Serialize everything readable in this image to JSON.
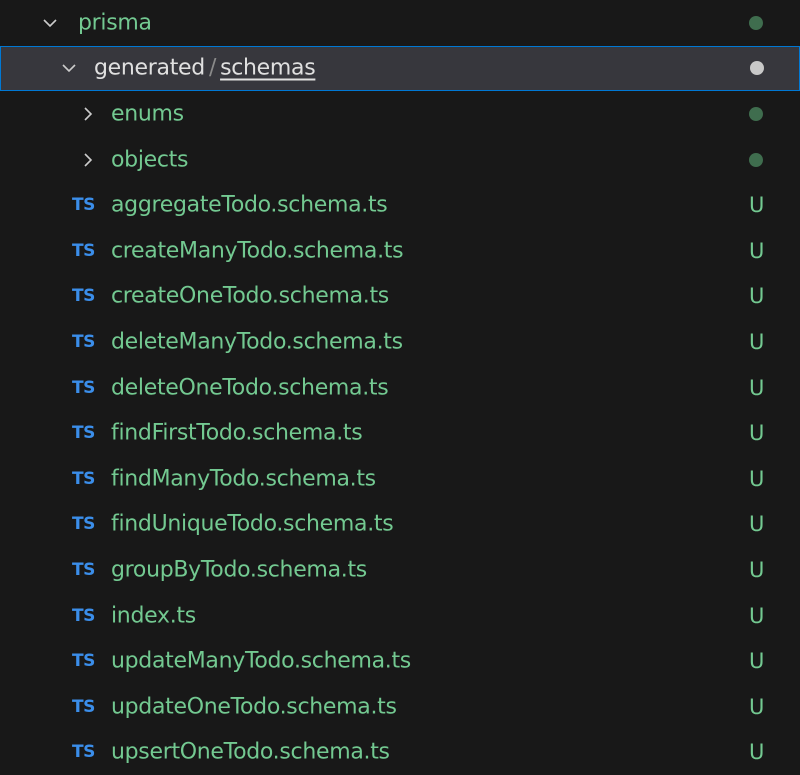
{
  "explorer": {
    "root_folder": {
      "label": "prisma",
      "expanded": true,
      "status": "dot",
      "status_color": "#3f6d4e"
    },
    "selected_folder": {
      "label_part1": "generated",
      "separator": "/",
      "label_part2": "schemas",
      "expanded": true,
      "status": "dot",
      "status_color": "#c8c8c8"
    },
    "subfolders": [
      {
        "label": "enums",
        "expanded": false,
        "status": "dot",
        "status_color": "#3f6d4e"
      },
      {
        "label": "objects",
        "expanded": false,
        "status": "dot",
        "status_color": "#3f6d4e"
      }
    ],
    "file_icon_text": "TS",
    "files": [
      {
        "label": "aggregateTodo.schema.ts",
        "status": "U"
      },
      {
        "label": "createManyTodo.schema.ts",
        "status": "U"
      },
      {
        "label": "createOneTodo.schema.ts",
        "status": "U"
      },
      {
        "label": "deleteManyTodo.schema.ts",
        "status": "U"
      },
      {
        "label": "deleteOneTodo.schema.ts",
        "status": "U"
      },
      {
        "label": "findFirstTodo.schema.ts",
        "status": "U"
      },
      {
        "label": "findManyTodo.schema.ts",
        "status": "U"
      },
      {
        "label": "findUniqueTodo.schema.ts",
        "status": "U"
      },
      {
        "label": "groupByTodo.schema.ts",
        "status": "U"
      },
      {
        "label": "index.ts",
        "status": "U"
      },
      {
        "label": "updateManyTodo.schema.ts",
        "status": "U"
      },
      {
        "label": "updateOneTodo.schema.ts",
        "status": "U"
      },
      {
        "label": "upsertOneTodo.schema.ts",
        "status": "U"
      }
    ]
  }
}
